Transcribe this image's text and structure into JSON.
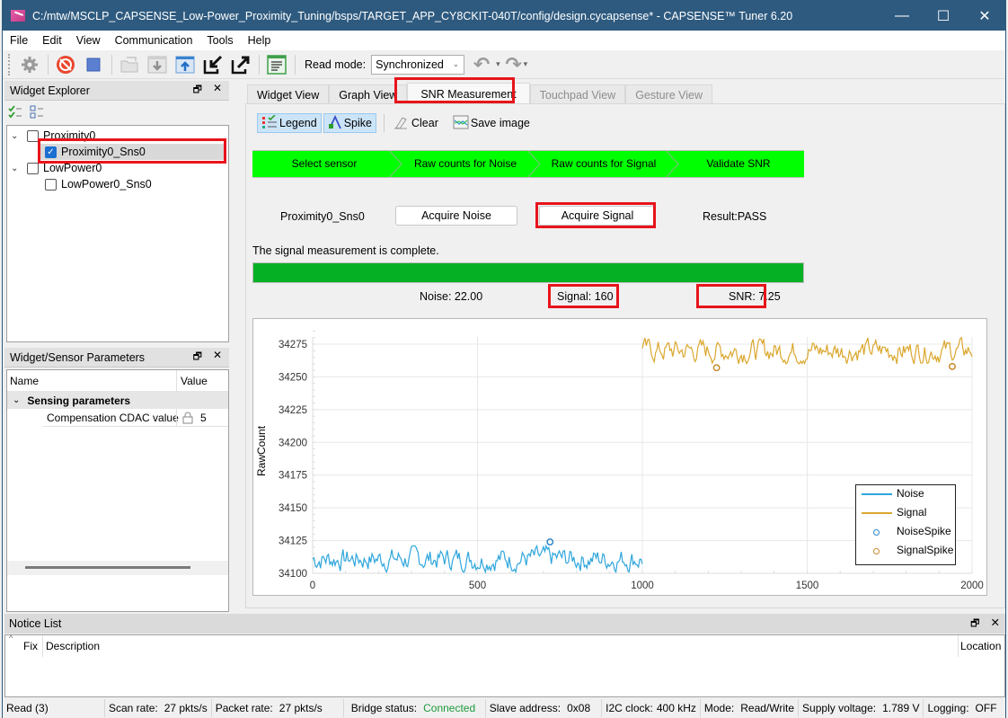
{
  "window": {
    "title": "C:/mtw/MSCLP_CAPSENSE_Low-Power_Proximity_Tuning/bsps/TARGET_APP_CY8CKIT-040T/config/design.cycapsense* - CAPSENSE™ Tuner 6.20",
    "minimize": "—",
    "maximize": "☐",
    "close": "✕"
  },
  "menu": [
    "File",
    "Edit",
    "View",
    "Communication",
    "Tools",
    "Help"
  ],
  "toolbar": {
    "icons": [
      "gear-icon",
      "disconnect-icon",
      "stop-icon",
      "open-folder-icon",
      "read-from-device-icon",
      "write-to-device-icon",
      "import-icon",
      "export-icon",
      "log-icon"
    ],
    "read_mode_label": "Read mode:",
    "read_mode_value": "Synchronized",
    "undo": "↶",
    "redo": "↷",
    "dropdown": "▾"
  },
  "widget_explorer": {
    "title": "Widget Explorer",
    "float": "🗗",
    "close": "✕",
    "tree": [
      {
        "label": "Proximity0",
        "checked": false,
        "children": [
          {
            "label": "Proximity0_Sns0",
            "checked": true,
            "selected": true
          }
        ]
      },
      {
        "label": "LowPower0",
        "checked": false,
        "children": [
          {
            "label": "LowPower0_Sns0",
            "checked": false
          }
        ]
      }
    ]
  },
  "params": {
    "title": "Widget/Sensor Parameters",
    "float": "🗗",
    "close": "✕",
    "col_name": "Name",
    "col_value": "Value",
    "group": "Sensing parameters",
    "rows": [
      {
        "name": "Compensation CDAC value",
        "value": "5",
        "locked": true
      }
    ]
  },
  "tabs": [
    {
      "label": "Widget View",
      "state": "normal"
    },
    {
      "label": "Graph View",
      "state": "normal"
    },
    {
      "label": "SNR Measurement",
      "state": "active"
    },
    {
      "label": "Touchpad View",
      "state": "disabled"
    },
    {
      "label": "Gesture View",
      "state": "disabled"
    }
  ],
  "snr": {
    "actions": {
      "legend": "Legend",
      "spike": "Spike",
      "clear": "Clear",
      "save_image": "Save image"
    },
    "steps": [
      "Select sensor",
      "Raw counts for Noise",
      "Raw counts for Signal",
      "Validate SNR"
    ],
    "step_color": "#00ff00",
    "sensor": "Proximity0_Sns0",
    "acquire_noise": "Acquire Noise",
    "acquire_signal": "Acquire Signal",
    "result": "Result:PASS",
    "status_message": "The signal measurement is complete.",
    "progress": 1.0,
    "progress_color": "#06b025",
    "noise_label": "Noise:  22.00",
    "signal_label": "Signal:  160",
    "snr_label": "SNR:  7.25"
  },
  "chart_data": {
    "type": "line",
    "title": "",
    "xlabel": "",
    "ylabel": "RawCount",
    "xlim": [
      0,
      2000
    ],
    "ylim": [
      34100,
      34285
    ],
    "xticks": [
      0,
      500,
      1000,
      1500,
      2000
    ],
    "yticks": [
      34100,
      34125,
      34150,
      34175,
      34200,
      34225,
      34250,
      34275
    ],
    "grid": true,
    "legend_position": "bottom-right",
    "series": [
      {
        "name": "Noise",
        "kind": "line",
        "color": "#2fa6dc",
        "x_range": [
          0,
          1000
        ],
        "baseline": 34111,
        "amplitude": 10
      },
      {
        "name": "Signal",
        "kind": "line",
        "color": "#dba72e",
        "x_range": [
          1000,
          2000
        ],
        "baseline": 34270,
        "amplitude": 10
      },
      {
        "name": "NoiseSpike",
        "kind": "marker",
        "color": "#2f86c8",
        "points": [
          [
            720,
            34124
          ]
        ]
      },
      {
        "name": "SignalSpike",
        "kind": "marker",
        "color": "#c98a2c",
        "points": [
          [
            1225,
            34257
          ],
          [
            1940,
            34258
          ]
        ]
      }
    ]
  },
  "notice": {
    "title": "Notice List",
    "float": "🗗",
    "close": "✕",
    "col_fix": "Fix",
    "col_description": "Description",
    "col_location": "Location"
  },
  "statusbar": {
    "read": "Read (3)",
    "scan_rate_label": "Scan rate:",
    "scan_rate": "27 pkts/s",
    "packet_rate_label": "Packet rate:",
    "packet_rate": "27 pkts/s",
    "bridge_label": "Bridge status:",
    "bridge": "Connected",
    "bridge_color": "#1e9a3a",
    "slave_label": "Slave address:",
    "slave": "0x08",
    "i2c_label": "I2C clock:",
    "i2c": "400 kHz",
    "mode_label": "Mode:",
    "mode": "Read/Write",
    "voltage_label": "Supply voltage:",
    "voltage": "1.789 V",
    "logging_label": "Logging:",
    "logging": "OFF"
  }
}
